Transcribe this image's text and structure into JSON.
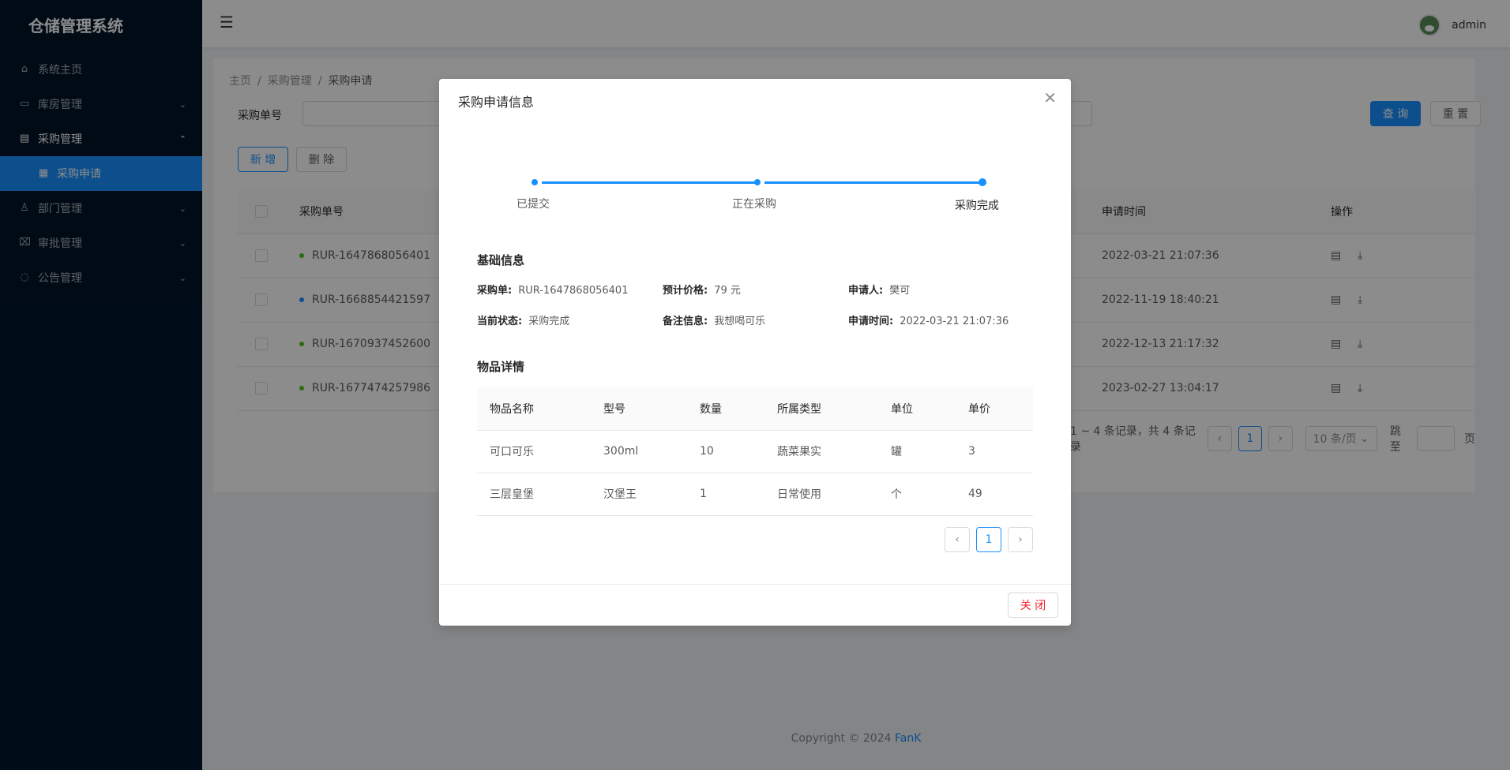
{
  "app": {
    "title": "仓储管理系统"
  },
  "sidebar": {
    "items": [
      {
        "label": "系统主页",
        "icon": "home-icon"
      },
      {
        "label": "库房管理",
        "icon": "lock-icon"
      },
      {
        "label": "采购管理",
        "icon": "document-icon"
      },
      {
        "label": "采购申请",
        "icon": "calendar-icon",
        "active": true
      },
      {
        "label": "部门管理",
        "icon": "user-icon"
      },
      {
        "label": "审批管理",
        "icon": "approval-icon"
      },
      {
        "label": "公告管理",
        "icon": "message-icon"
      }
    ]
  },
  "header": {
    "username": "admin"
  },
  "breadcrumb": [
    "主页",
    "采购管理",
    "采购申请"
  ],
  "search": {
    "label": "采购单号",
    "query_btn": "查 询",
    "reset_btn": "重 置"
  },
  "toolbar": {
    "add": "新 增",
    "delete": "删 除"
  },
  "table": {
    "columns": [
      "采购单号",
      "申请时间",
      "操作"
    ],
    "rows": [
      {
        "no": "RUR-1647868056401",
        "time": "2022-03-21 21:07:36",
        "status": "green"
      },
      {
        "no": "RUR-1668854421597",
        "time": "2022-11-19 18:40:21",
        "status": "blue"
      },
      {
        "no": "RUR-1670937452600",
        "time": "2022-12-13 21:17:32",
        "status": "green"
      },
      {
        "no": "RUR-1677474257986",
        "time": "2023-02-27 13:04:17",
        "status": "green"
      }
    ]
  },
  "pagination": {
    "summary": "1 ~ 4 条记录，共 4 条记录",
    "page": "1",
    "size": "10 条/页",
    "jump_label": "跳至",
    "page_suffix": "页"
  },
  "footer": {
    "copyright": "Copyright © 2024 ",
    "link": "FanK"
  },
  "modal": {
    "title": "采购申请信息",
    "steps": [
      "已提交",
      "正在采购",
      "采购完成"
    ],
    "basic_title": "基础信息",
    "basic": {
      "no_k": "采购单:",
      "no_v": "RUR-1647868056401",
      "price_k": "预计价格:",
      "price_v": "79 元",
      "applicant_k": "申请人:",
      "applicant_v": "樊可",
      "status_k": "当前状态:",
      "status_v": "采购完成",
      "remark_k": "备注信息:",
      "remark_v": "我想喝可乐",
      "time_k": "申请时间:",
      "time_v": "2022-03-21 21:07:36"
    },
    "items_title": "物品详情",
    "items_columns": [
      "物品名称",
      "型号",
      "数量",
      "所属类型",
      "单位",
      "单价"
    ],
    "items_rows": [
      [
        "可口可乐",
        "300ml",
        "10",
        "蔬菜果实",
        "罐",
        "3"
      ],
      [
        "三层皇堡",
        "汉堡王",
        "1",
        "日常使用",
        "个",
        "49"
      ]
    ],
    "page": "1",
    "close_btn": "关 闭"
  }
}
